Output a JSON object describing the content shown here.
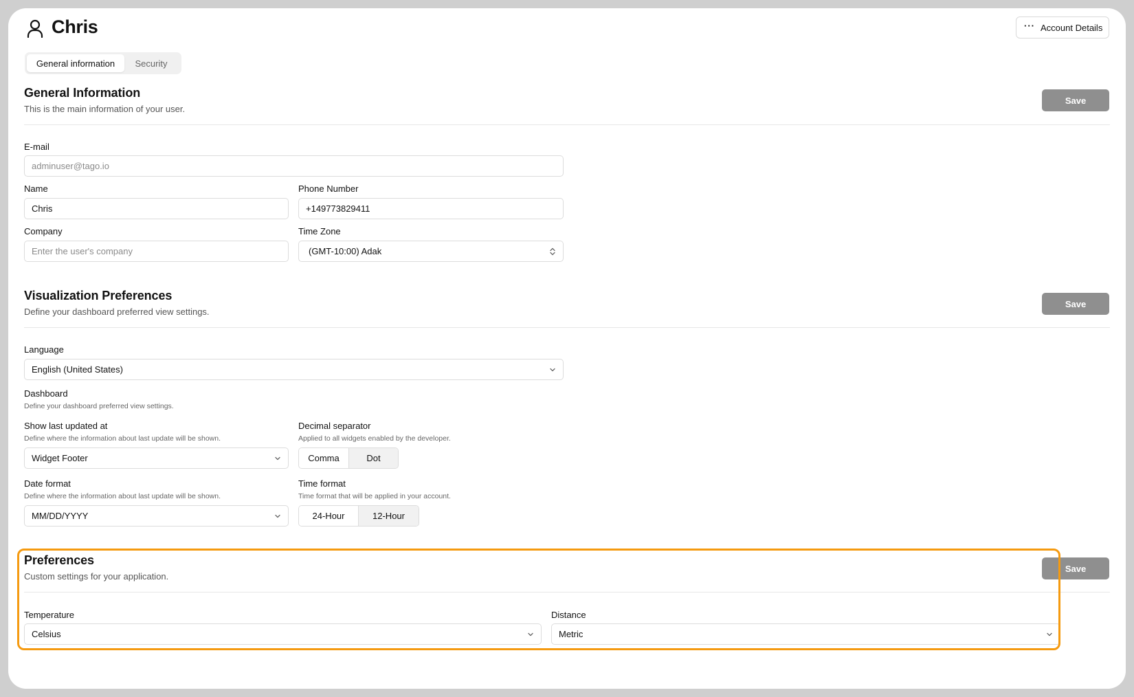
{
  "header": {
    "title": "Chris",
    "account_button": "Account Details",
    "icons": {
      "user": "user-icon",
      "more": "more-horizontal-icon"
    }
  },
  "tabs": [
    {
      "label": "General information",
      "active": true
    },
    {
      "label": "Security",
      "active": false
    }
  ],
  "general": {
    "title": "General Information",
    "description": "This is the main information of your user.",
    "save": "Save",
    "email": {
      "label": "E-mail",
      "value": "adminuser@tago.io"
    },
    "name": {
      "label": "Name",
      "value": "Chris"
    },
    "phone": {
      "label": "Phone Number",
      "value": "+149773829411"
    },
    "company": {
      "label": "Company",
      "placeholder": "Enter the user's company"
    },
    "timezone": {
      "label": "Time Zone",
      "value": "(GMT-10:00) Adak"
    }
  },
  "visualization": {
    "title": "Visualization Preferences",
    "description": "Define your dashboard preferred view settings.",
    "save": "Save",
    "language": {
      "label": "Language",
      "value": "English (United States)"
    },
    "dashboard": {
      "label": "Dashboard",
      "hint": "Define your dashboard preferred view settings."
    },
    "last_updated": {
      "label": "Show last updated at",
      "hint": "Define where the information about last update will be shown.",
      "value": "Widget Footer"
    },
    "decimal": {
      "label": "Decimal separator",
      "hint": "Applied to all widgets enabled by the developer.",
      "options": [
        "Comma",
        "Dot"
      ],
      "selected": "Comma"
    },
    "date_format": {
      "label": "Date format",
      "hint": "Define where the information about last update will be shown.",
      "value": "MM/DD/YYYY"
    },
    "time_format": {
      "label": "Time format",
      "hint": "Time format that will be applied in your account.",
      "options": [
        "24-Hour",
        "12-Hour"
      ],
      "selected": "24-Hour"
    }
  },
  "preferences": {
    "title": "Preferences",
    "description": "Custom settings for your application.",
    "save": "Save",
    "temperature": {
      "label": "Temperature",
      "value": "Celsius"
    },
    "distance": {
      "label": "Distance",
      "value": "Metric"
    }
  },
  "colors": {
    "highlight": "#f59a10",
    "save_button": "#8f8f8f",
    "frame": "#cfcfcf"
  }
}
